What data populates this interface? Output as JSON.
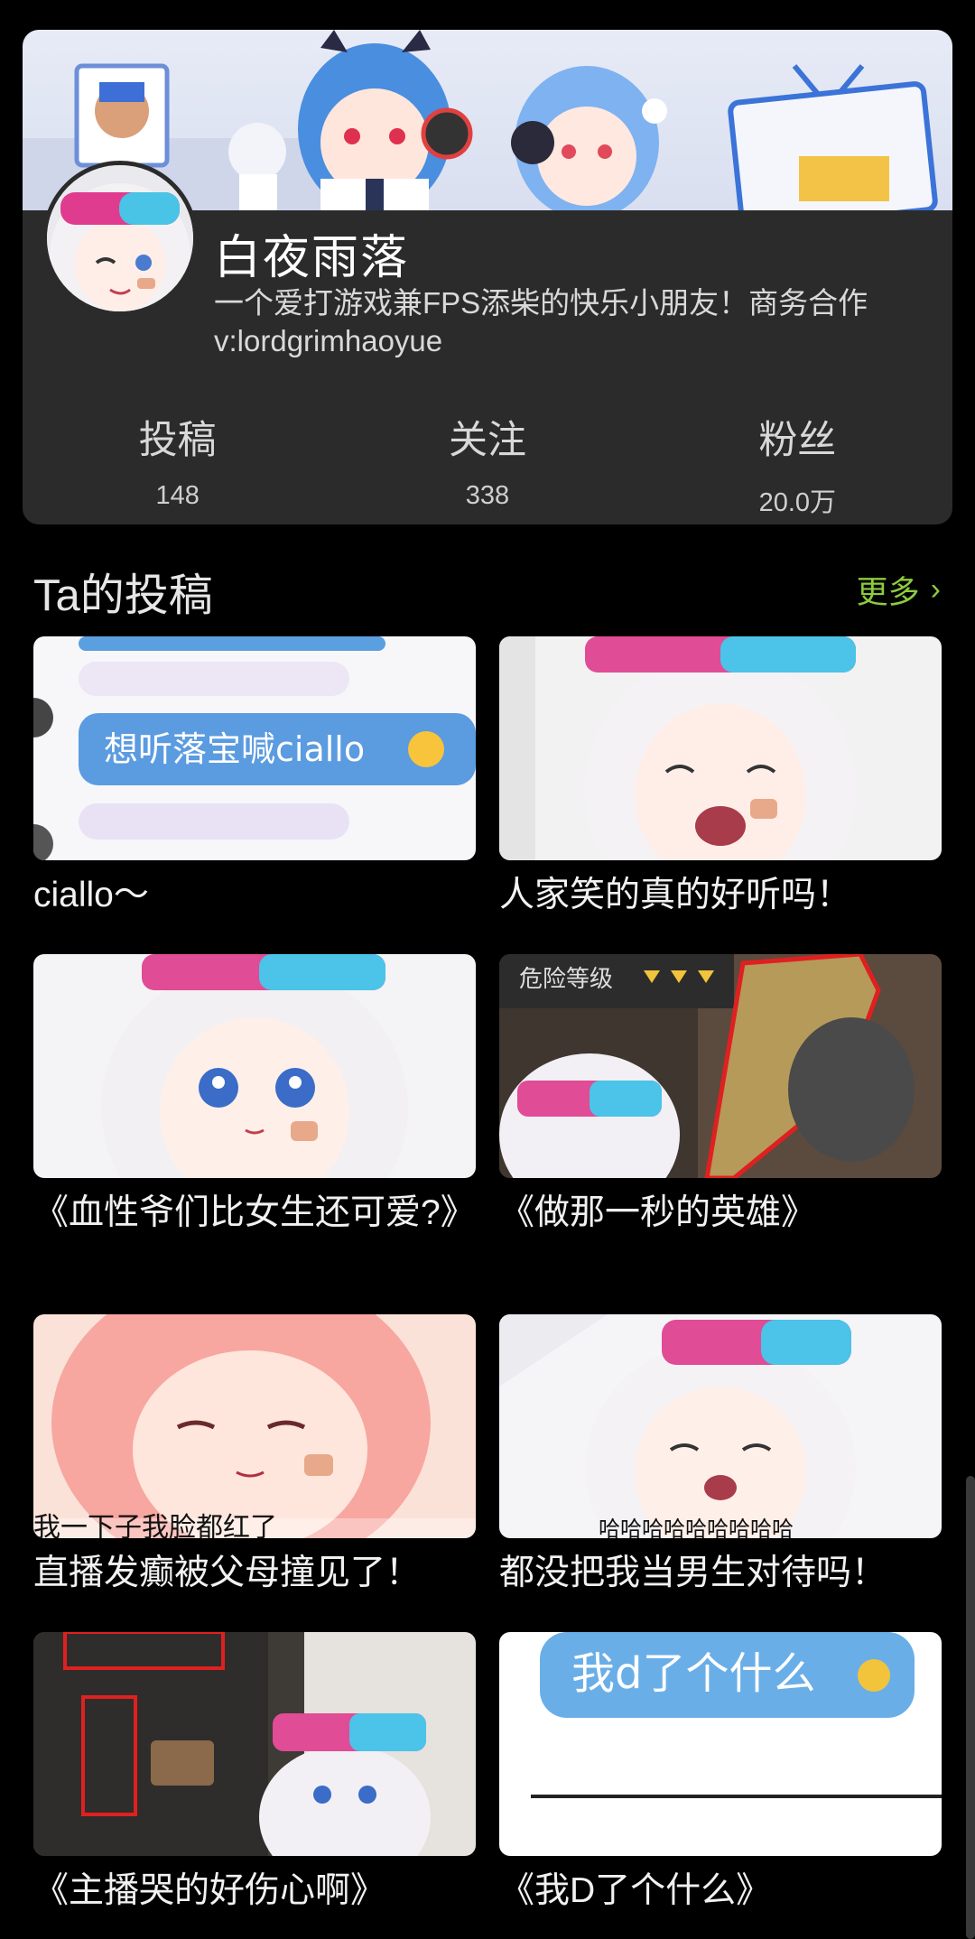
{
  "profile": {
    "name": "白夜雨落",
    "bio": "一个爱打游戏兼FPS添柴的快乐小朋友！商务合作v:lordgrimhaoyue",
    "stats": [
      {
        "label": "投稿",
        "value": "148"
      },
      {
        "label": "关注",
        "value": "338"
      },
      {
        "label": "粉丝",
        "value": "20.0万"
      }
    ]
  },
  "section": {
    "title": "Ta的投稿",
    "more_label": "更多",
    "more_icon": "chevron-right-icon"
  },
  "videos": [
    {
      "caption": "ciallo～",
      "thumb_text": "想听落宝喊ciallo"
    },
    {
      "caption": "人家笑的真的好听吗！"
    },
    {
      "caption": "《血性爷们比女生还可爱?》"
    },
    {
      "caption": "《做那一秒的英雄》",
      "thumb_text": "危险等级"
    },
    {
      "caption": "直播发癫被父母撞见了！",
      "thumb_text": "我一下子我脸都红了"
    },
    {
      "caption": "都没把我当男生对待吗！",
      "thumb_text": "哈哈哈哈哈哈哈哈哈"
    },
    {
      "caption": "《主播哭的好伤心啊》"
    },
    {
      "caption": "《我D了个什么》",
      "thumb_text": "我d了个什么"
    }
  ],
  "colors": {
    "accent": "#8ecb3e",
    "card_bg": "#2b2b2b",
    "page_bg": "#000000"
  }
}
